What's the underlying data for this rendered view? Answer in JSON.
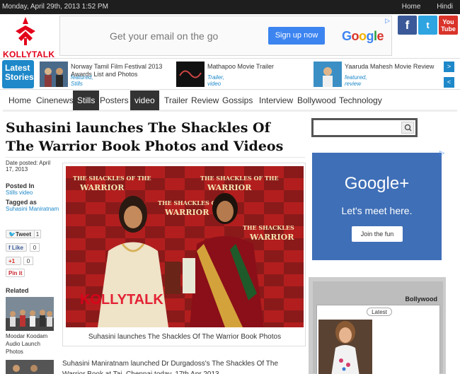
{
  "topbar": {
    "date": "Monday, April 29th, 2013 1:52 PM",
    "links": [
      "Home",
      "Hindi"
    ]
  },
  "logo": {
    "text": "KOLLYTALK",
    "icon": "kollytalk-logo-icon"
  },
  "google_banner": {
    "text": "Get your email on the go",
    "button": "Sign up now",
    "brand": "Google",
    "ad_icon": "adchoices-icon"
  },
  "social": [
    {
      "name": "facebook-icon",
      "glyph": "f",
      "color": "#3b5998"
    },
    {
      "name": "twitter-icon",
      "glyph": "t",
      "color": "#2ea4e1"
    },
    {
      "name": "youtube-icon",
      "glyph": "You Tube",
      "color": "#d9332a"
    }
  ],
  "latest": {
    "label": "Latest Stories",
    "items": [
      {
        "title": "Norway Tamil Film Festival 2013 Awards List and Photos",
        "cat": "featured, Stills"
      },
      {
        "title": "Mathapoo Movie Trailer",
        "cat": "Trailer, video"
      },
      {
        "title": "Yaaruda Mahesh Movie Review",
        "cat": "featured, review"
      }
    ],
    "arrows": [
      ">",
      "<"
    ]
  },
  "nav": {
    "items": [
      "Home",
      "Cinenews",
      "Stills",
      "Posters",
      "video",
      "Trailer",
      "Review",
      "Gossips",
      "Interview",
      "Bollywood",
      "Technology"
    ],
    "active": [
      "Stills",
      "video"
    ]
  },
  "article": {
    "headline": "Suhasini launches The Shackles Of The Warrior Book Photos and Videos",
    "date_posted": "Date posted: April 17, 2013",
    "posted_in_label": "Posted In",
    "posted_in": "Stills video",
    "tagged_label": "Tagged as",
    "tagged": "Suhasini Maniratnam",
    "photo_caption": "Suhasini launches The Shackles Of The Warrior Book Photos",
    "photo_banner": "THE SHACKLES OF THE WARRIOR",
    "watermark": "KOLLYTALK",
    "body": "Suhasini Maniratnam launched Dr Durgadoss's The Shackles Of The Warrior Book at Taj, Chennai today, 17th Apr 2013."
  },
  "share": {
    "tweet": "Tweet",
    "tweet_count": "1",
    "like": "Like",
    "like_count": "0",
    "gplus": "+1",
    "gplus_count": "0",
    "pin": "Pin it"
  },
  "related": {
    "heading": "Related",
    "items": [
      {
        "caption": "Moodar Koodam Audio Launch Photos"
      }
    ]
  },
  "sidebar": {
    "search_placeholder": "",
    "gplus_ad": {
      "title": "Google+",
      "subtitle": "Let's meet here.",
      "button": "Join the fun"
    },
    "bollywood": {
      "title": "Bollywood",
      "tab": "Latest"
    }
  }
}
